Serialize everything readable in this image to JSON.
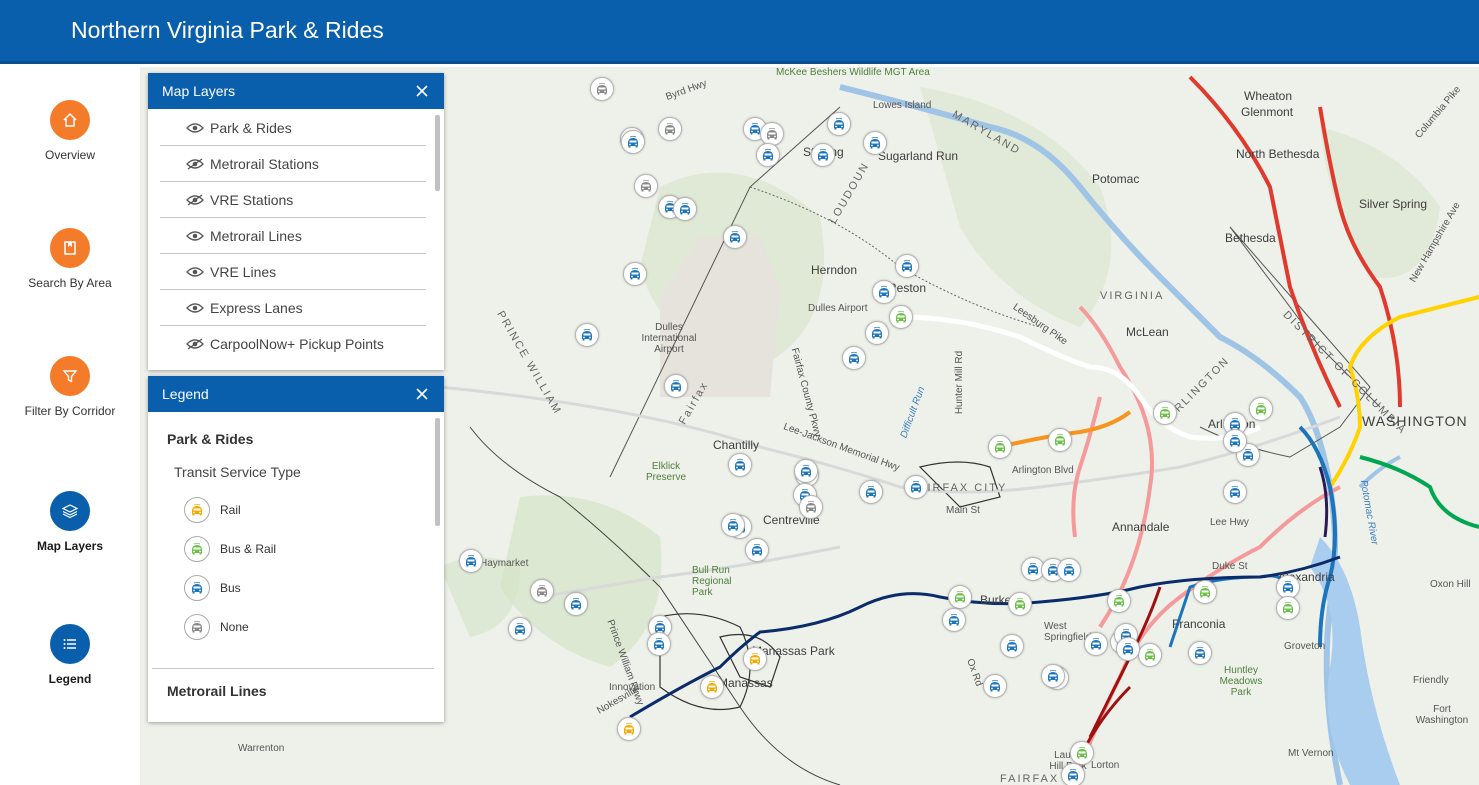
{
  "app": {
    "title": "Northern Virginia Park & Rides"
  },
  "nav": [
    {
      "label": "Overview",
      "icon": "home-icon",
      "color": "#f47b2a"
    },
    {
      "label": "Search By Area",
      "icon": "bookmark-icon",
      "color": "#f47b2a"
    },
    {
      "label": "Filter By Corridor",
      "icon": "filter-icon",
      "color": "#f47b2a"
    },
    {
      "label": "Map Layers",
      "icon": "layers-icon",
      "color": "#0a5fad"
    },
    {
      "label": "Legend",
      "icon": "list-icon",
      "color": "#0a5fad"
    }
  ],
  "map_layers": {
    "title": "Map Layers",
    "items": [
      {
        "label": "Park & Rides",
        "visible": true
      },
      {
        "label": "Metrorail Stations",
        "visible": false
      },
      {
        "label": "VRE Stations",
        "visible": false
      },
      {
        "label": "Metrorail Lines",
        "visible": true
      },
      {
        "label": "VRE Lines",
        "visible": true
      },
      {
        "label": "Express Lanes",
        "visible": true
      },
      {
        "label": "CarpoolNow+ Pickup Points",
        "visible": false
      }
    ]
  },
  "legend": {
    "title": "Legend",
    "section": "Park & Rides",
    "subsection": "Transit Service Type",
    "items": [
      {
        "label": "Rail",
        "color": "#f5a800"
      },
      {
        "label": "Bus & Rail",
        "color": "#6cc04a"
      },
      {
        "label": "Bus",
        "color": "#1c74bc"
      },
      {
        "label": "None",
        "color": "#888888"
      }
    ],
    "next_section": "Metrorail Lines"
  },
  "map_labels": [
    "McKee Beshers Wildlife MGT Area",
    "Lowes Island",
    "Sterling",
    "Sugarland Run",
    "MARYLAND",
    "Wheaton",
    "Glenmont",
    "North Bethesda",
    "Potomac",
    "Silver Spring",
    "Bethesda",
    "Herndon",
    "Reston",
    "Dulles Airport",
    "Dulles International Airport",
    "VIRGINIA",
    "McLean",
    "ARLINGTON",
    "DISTRICT OF COLUMBIA",
    "WASHINGTON",
    "Arlington",
    "Chantilly",
    "Centreville",
    "FAIRFAX CITY",
    "Fairfax",
    "Arlington Blvd",
    "Annandale",
    "Alexandria",
    "Burke",
    "West Springfield",
    "Franconia",
    "Groveton",
    "Haymarket",
    "Bull Run Regional Park",
    "Manassas Park",
    "Manassas",
    "Innovation",
    "Nokesville",
    "Warrenton",
    "Huntley Meadows Park",
    "Friendly",
    "Fort Washington",
    "Mt Vernon",
    "Lorton",
    "Laurel Hill Park",
    "Oxon Hill",
    "PRINCE WILLIAM",
    "LOUDOUN",
    "FAIRFAX",
    "Elklick Preserve",
    "Lee-Jackson Memorial Hwy",
    "Leesburg Pike",
    "Duke St",
    "Main St",
    "Difficult Run",
    "Potomac River",
    "Columbia Pike",
    "New Hampshire Ave",
    "Hunter Mill Rd",
    "Lee Hwy",
    "Fairfax County Pkwy",
    "Ox Rd",
    "Prince William Pkwy",
    "Byrd Hwy"
  ],
  "colors": {
    "header": "#0a5fad",
    "metro_red": "#e03a2e",
    "metro_orange": "#f7941d",
    "metro_silver": "#ffffff",
    "metro_yellow": "#ffd200",
    "metro_green": "#00a650",
    "metro_blue": "#1c74bc",
    "vre": "#0b2c6b",
    "express_lanes": "#f5a0a0"
  }
}
